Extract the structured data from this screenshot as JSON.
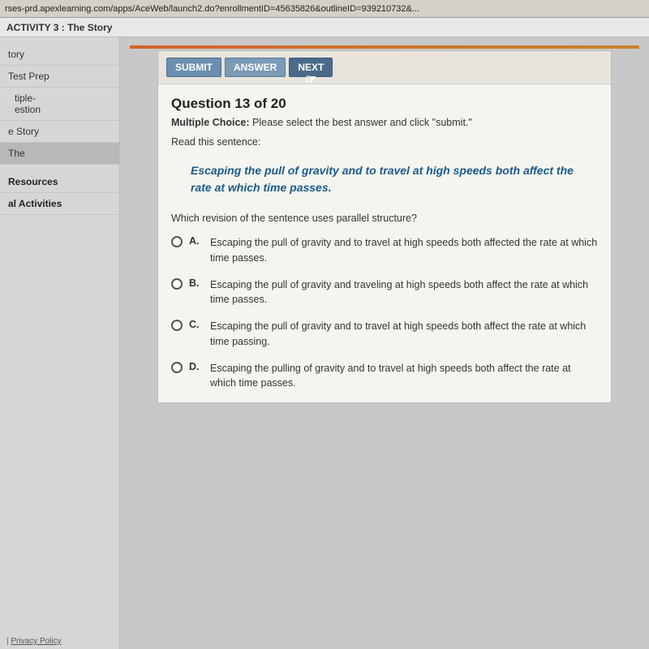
{
  "browser": {
    "url": "rses-prd.apexlearning.com/apps/AceWeb/launch2.do?enrollmentID=45635826&outlineID=939210732&..."
  },
  "activity_bar": {
    "label": "ACTIVITY 3 : The Story"
  },
  "sidebar": {
    "items": [
      {
        "id": "story",
        "label": "tory",
        "indented": false
      },
      {
        "id": "test-prep",
        "label": "Test Prep",
        "indented": false
      },
      {
        "id": "multiple-question",
        "label": "tiple-\nestion",
        "indented": true
      },
      {
        "id": "the-story",
        "label": "e Story",
        "indented": false
      },
      {
        "id": "the",
        "label": "The",
        "indented": false
      },
      {
        "id": "resources",
        "label": "Resources",
        "indented": false,
        "section": true
      },
      {
        "id": "additional-activities",
        "label": "al Activities",
        "indented": false,
        "section": true
      }
    ]
  },
  "toolbar": {
    "submit_label": "SUBMIT",
    "answer_label": "ANSWER",
    "next_label": "NEXT"
  },
  "question": {
    "number": "Question 13 of 20",
    "type_label": "Multiple Choice:",
    "type_instruction": "Please select the best answer and click \"submit.\"",
    "read_prompt": "Read this sentence:",
    "quote": "Escaping the pull of gravity and to travel at high speeds both affect the rate at which time passes.",
    "revision_prompt": "Which revision of the sentence uses parallel structure?",
    "choices": [
      {
        "letter": "A.",
        "text": "Escaping the pull of gravity and to travel at high speeds both affected the rate at which time passes."
      },
      {
        "letter": "B.",
        "text": "Escaping the pull of gravity and traveling at high speeds both affect the rate at which time passes."
      },
      {
        "letter": "C.",
        "text": "Escaping the pull of gravity and to travel at high speeds both affect the rate at which time passing."
      },
      {
        "letter": "D.",
        "text": "Escaping the pulling of gravity and to travel at high speeds both affect the rate at which time passes."
      }
    ]
  },
  "footer": {
    "privacy_label": "Privacy Policy"
  }
}
